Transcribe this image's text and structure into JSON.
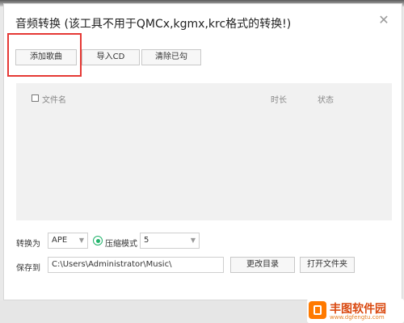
{
  "dialog": {
    "title": "音频转换 (该工具不用于QMCx,kgmx,krc格式的转换!)",
    "close_icon": "close-icon"
  },
  "toolbar": {
    "add_song": "添加歌曲",
    "import_cd": "导入CD",
    "clear_checked": "清除已勾"
  },
  "list": {
    "headers": {
      "filename": "文件名",
      "duration": "时长",
      "status": "状态"
    },
    "rows": []
  },
  "convert": {
    "label": "转换为",
    "format": "APE",
    "compress_label": "压缩模式",
    "compress_value": "5"
  },
  "save": {
    "label": "保存到",
    "path": "C:\\Users\\Administrator\\Music\\",
    "change_dir": "更改目录",
    "open_folder": "打开文件夹"
  },
  "watermark": {
    "main": "丰图软件园",
    "sub": "www.dgfengtu.com"
  },
  "colors": {
    "accent": "#22b36b",
    "highlight": "#e53935",
    "brand": "#ff7a00"
  }
}
